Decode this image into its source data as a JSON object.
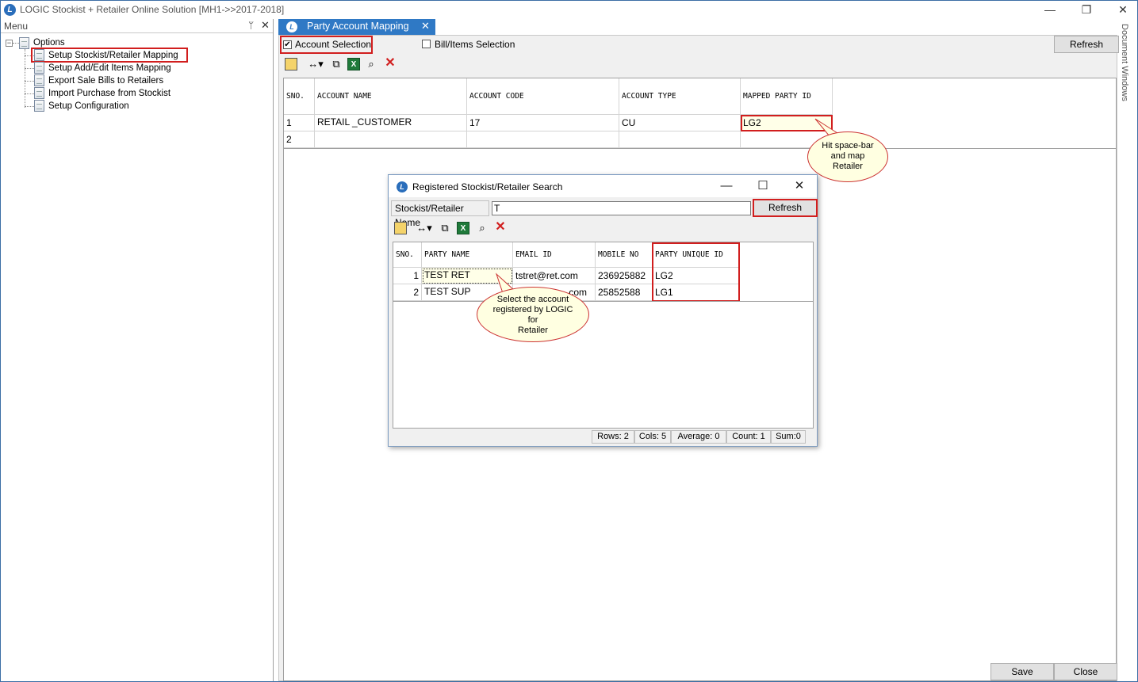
{
  "window": {
    "title": "LOGIC Stockist + Retailer Online Solution [MH1->>2017-2018]",
    "minimize": "—",
    "restore": "❐",
    "close": "✕"
  },
  "menu": {
    "title": "Menu",
    "pin": "ᛘ",
    "close": "✕",
    "root_expander": "−",
    "root_label": "Options",
    "items": [
      {
        "label": "Setup Stockist/Retailer Mapping"
      },
      {
        "label": "Setup Add/Edit Items Mapping"
      },
      {
        "label": "Export Sale Bills to Retailers"
      },
      {
        "label": "Import Purchase from Stockist"
      },
      {
        "label": "Setup Configuration"
      }
    ]
  },
  "tab": {
    "label": "Party Account Mapping",
    "close": "✕",
    "icon": "L"
  },
  "side_panel": {
    "document_windows": "Document Windows"
  },
  "options": {
    "account_selection": "Account Selection",
    "account_selection_checked": "✔",
    "bill_items_selection": "Bill/Items Selection",
    "refresh": "Refresh"
  },
  "main_grid": {
    "headers": [
      "SNO.",
      "ACCOUNT NAME",
      "ACCOUNT CODE",
      "ACCOUNT TYPE",
      "MAPPED PARTY ID"
    ],
    "rows": [
      [
        "1",
        "RETAIL _CUSTOMER",
        "17",
        "CU",
        "LG2"
      ],
      [
        "2",
        "",
        "",
        "",
        ""
      ]
    ]
  },
  "callouts": {
    "map_hint": [
      "Hit space-bar",
      "and map",
      "Retailer"
    ],
    "select_hint": [
      "Select the account",
      "registered by LOGIC",
      "for",
      "Retailer"
    ]
  },
  "dialog": {
    "title": "Registered Stockist/Retailer Search",
    "search_label": "Stockist/Retailer Name",
    "search_value": "T",
    "refresh": "Refresh",
    "minimize": "—",
    "maximize": "☐",
    "close": "✕",
    "headers": [
      "SNO.",
      "PARTY NAME",
      "EMAIL ID",
      "MOBILE NO",
      "PARTY UNIQUE ID"
    ],
    "rows": [
      [
        "1",
        "TEST RET",
        "tstret@ret.com",
        "236925882",
        "LG2"
      ],
      [
        "2",
        "TEST SUP",
        ".com",
        "25852588",
        "LG1"
      ]
    ],
    "status": {
      "rows": "Rows: 2",
      "cols": "Cols: 5",
      "average": "Average: 0",
      "count": "Count: 1",
      "sum": "Sum:0"
    }
  },
  "footer": {
    "save": "Save",
    "close": "Close"
  },
  "colors": {
    "accent": "#2f79c5",
    "highlight_box": "#d11e1e",
    "callout_fill": "#ffffe1"
  }
}
